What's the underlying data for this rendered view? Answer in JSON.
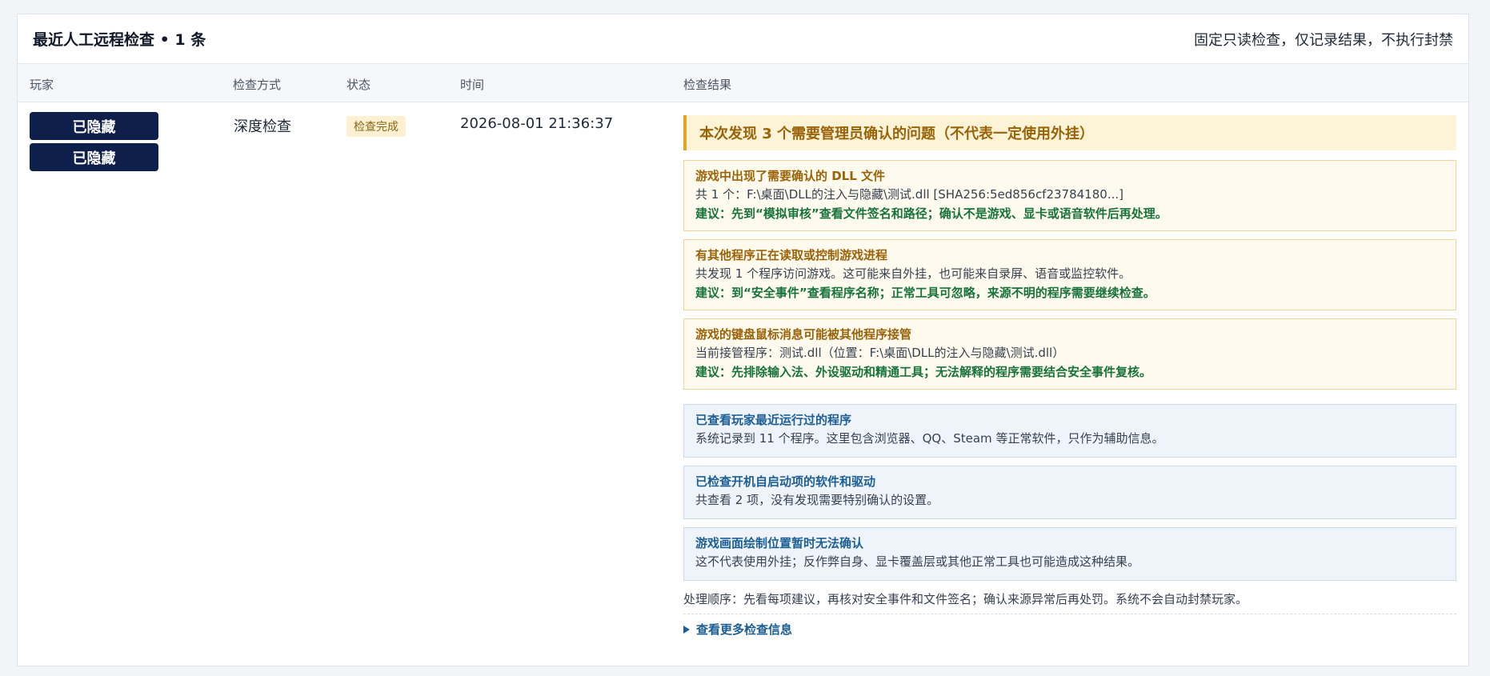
{
  "header": {
    "title": "最近人工远程检查 • 1 条",
    "note": "固定只读检查，仅记录结果，不执行封禁"
  },
  "columns": {
    "player": "玩家",
    "method": "检查方式",
    "status": "状态",
    "time": "时间",
    "result": "检查结果"
  },
  "row": {
    "players": [
      "已隐藏",
      "已隐藏"
    ],
    "method": "深度检查",
    "status": "检查完成",
    "time": "2026-08-01 21:36:37",
    "summary": "本次发现 3 个需要管理员确认的问题（不代表一定使用外挂）",
    "warnings": [
      {
        "title": "游戏中出现了需要确认的 DLL 文件",
        "body": "共 1 个：F:\\桌面\\DLL的注入与隐藏\\测试.dll [SHA256:5ed856cf23784180...]",
        "tip": "建议：先到“模拟审核”查看文件签名和路径；确认不是游戏、显卡或语音软件后再处理。"
      },
      {
        "title": "有其他程序正在读取或控制游戏进程",
        "body": "共发现 1 个程序访问游戏。这可能来自外挂，也可能来自录屏、语音或监控软件。",
        "tip": "建议：到“安全事件”查看程序名称；正常工具可忽略，来源不明的程序需要继续检查。"
      },
      {
        "title": "游戏的键盘鼠标消息可能被其他程序接管",
        "body": "当前接管程序：测试.dll（位置：F:\\桌面\\DLL的注入与隐藏\\测试.dll）",
        "tip": "建议：先排除输入法、外设驱动和精通工具；无法解释的程序需要结合安全事件复核。"
      }
    ],
    "infos": [
      {
        "title": "已查看玩家最近运行过的程序",
        "body": "系统记录到 11 个程序。这里包含浏览器、QQ、Steam 等正常软件，只作为辅助信息。"
      },
      {
        "title": "已检查开机自启动项的软件和驱动",
        "body": "共查看 2 项，没有发现需要特别确认的设置。"
      },
      {
        "title": "游戏画面绘制位置暂时无法确认",
        "body": "这不代表使用外挂；反作弊自身、显卡覆盖层或其他正常工具也可能造成这种结果。"
      }
    ],
    "footnote": "处理顺序：先看每项建议，再核对安全事件和文件签名；确认来源异常后再处罚。系统不会自动封禁玩家。",
    "more_link": "查看更多检查信息"
  }
}
